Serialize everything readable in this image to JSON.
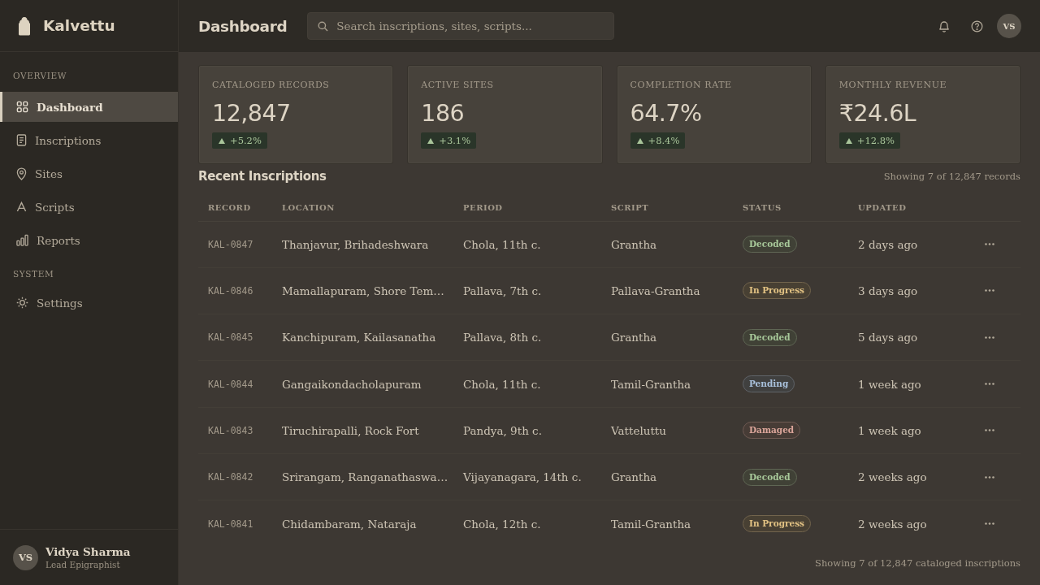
{
  "app": {
    "name": "Kalvettu"
  },
  "sidebar": {
    "sections": [
      {
        "title": "OVERVIEW",
        "items": [
          {
            "label": "Dashboard",
            "selected": true
          },
          {
            "label": "Inscriptions",
            "selected": false
          },
          {
            "label": "Sites",
            "selected": false
          },
          {
            "label": "Scripts",
            "selected": false
          },
          {
            "label": "Reports",
            "selected": false
          }
        ]
      },
      {
        "title": "SYSTEM",
        "items": [
          {
            "label": "Settings",
            "selected": false
          }
        ]
      }
    ],
    "user": {
      "initials": "VS",
      "name": "Vidya Sharma",
      "role": "Lead Epigraphist"
    }
  },
  "header": {
    "title": "Dashboard",
    "search": {
      "placeholder": "Search inscriptions, sites, scripts..."
    },
    "avatar": {
      "initials": "VS"
    }
  },
  "stats": [
    {
      "label": "CATALOGED RECORDS",
      "value": "12,847",
      "change": "+5.2%"
    },
    {
      "label": "ACTIVE SITES",
      "value": "186",
      "change": "+3.1%"
    },
    {
      "label": "COMPLETION RATE",
      "value": "64.7%",
      "change": "+8.4%"
    },
    {
      "label": "MONTHLY REVENUE",
      "value": "₹24.6L",
      "change": "+12.8%"
    }
  ],
  "recent": {
    "title": "Recent Inscriptions",
    "summary": "Showing 7 of 12,847 records",
    "columns": [
      "RECORD",
      "LOCATION",
      "PERIOD",
      "SCRIPT",
      "STATUS",
      "UPDATED"
    ],
    "rows": [
      {
        "record": "KAL-0847",
        "location": "Thanjavur, Brihadeshwara",
        "period": "Chola, 11th c.",
        "script": "Grantha",
        "status": {
          "label": "Decoded",
          "color": "#a8c99a"
        },
        "updated": "2 days ago"
      },
      {
        "record": "KAL-0846",
        "location": "Mamallapuram, Shore Tem…",
        "period": "Pallava, 7th c.",
        "script": "Pallava-Grantha",
        "status": {
          "label": "In Progress",
          "color": "#e2c283"
        },
        "updated": "3 days ago"
      },
      {
        "record": "KAL-0845",
        "location": "Kanchipuram, Kailasanatha",
        "period": "Pallava, 8th c.",
        "script": "Grantha",
        "status": {
          "label": "Decoded",
          "color": "#a8c99a"
        },
        "updated": "5 days ago"
      },
      {
        "record": "KAL-0844",
        "location": "Gangaikondacholapuram",
        "period": "Chola, 11th c.",
        "script": "Tamil-Grantha",
        "status": {
          "label": "Pending",
          "color": "#a9c1dc"
        },
        "updated": "1 week ago"
      },
      {
        "record": "KAL-0843",
        "location": "Tiruchirapalli, Rock Fort",
        "period": "Pandya, 9th c.",
        "script": "Vatteluttu",
        "status": {
          "label": "Damaged",
          "color": "#dca69b"
        },
        "updated": "1 week ago"
      },
      {
        "record": "KAL-0842",
        "location": "Srirangam, Ranganathaswa…",
        "period": "Vijayanagara, 14th c.",
        "script": "Grantha",
        "status": {
          "label": "Decoded",
          "color": "#a8c99a"
        },
        "updated": "2 weeks ago"
      },
      {
        "record": "KAL-0841",
        "location": "Chidambaram, Nataraja",
        "period": "Chola, 12th c.",
        "script": "Tamil-Grantha",
        "status": {
          "label": "In Progress",
          "color": "#e2c283"
        },
        "updated": "2 weeks ago"
      }
    ],
    "footer": "Showing 7 of 12,847 cataloged inscriptions"
  }
}
